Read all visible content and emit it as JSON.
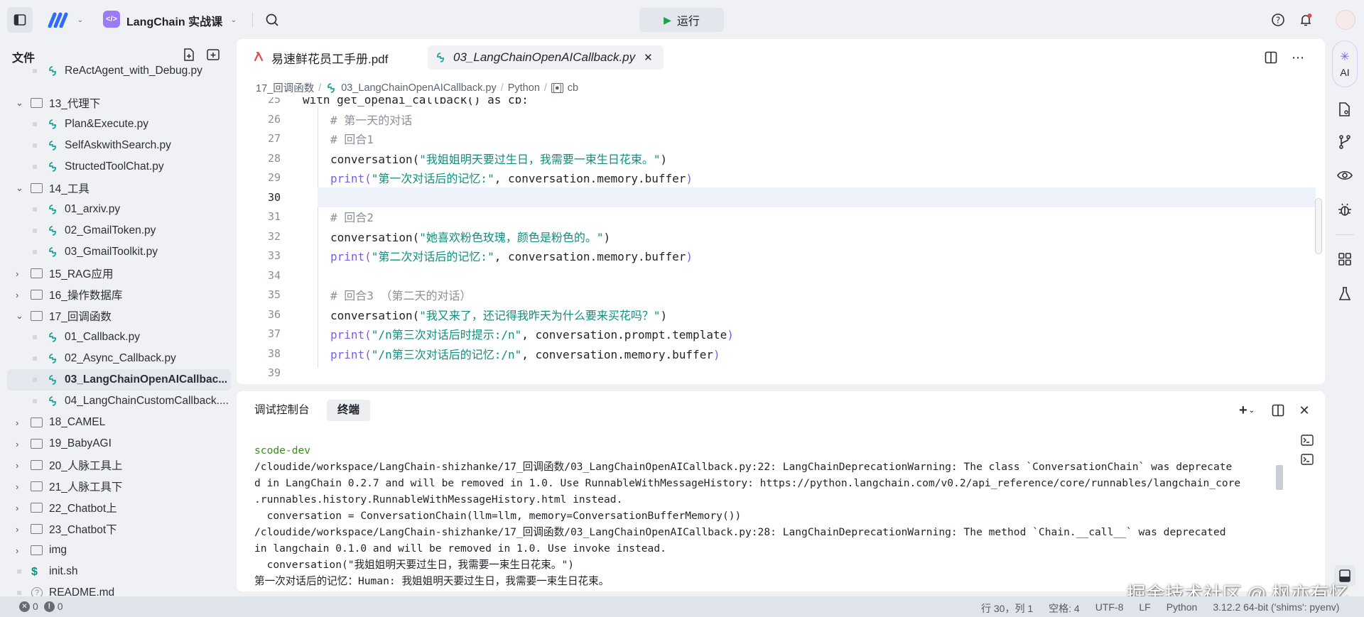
{
  "topbar": {
    "project_name": "LangChain 实战课",
    "run_label": "运行"
  },
  "sidebar": {
    "title": "文件",
    "items": [
      {
        "type": "file",
        "depth": 1,
        "label": "ReActAgent_with_Debug.py",
        "icon": "python"
      },
      {
        "type": "folder",
        "depth": 0,
        "open": true,
        "label": "13_代理下"
      },
      {
        "type": "file",
        "depth": 1,
        "label": "Plan&Execute.py",
        "icon": "python"
      },
      {
        "type": "file",
        "depth": 1,
        "label": "SelfAskwithSearch.py",
        "icon": "python"
      },
      {
        "type": "file",
        "depth": 1,
        "label": "StructedToolChat.py",
        "icon": "python"
      },
      {
        "type": "folder",
        "depth": 0,
        "open": true,
        "label": "14_工具"
      },
      {
        "type": "file",
        "depth": 1,
        "label": "01_arxiv.py",
        "icon": "python"
      },
      {
        "type": "file",
        "depth": 1,
        "label": "02_GmailToken.py",
        "icon": "python"
      },
      {
        "type": "file",
        "depth": 1,
        "label": "03_GmailToolkit.py",
        "icon": "python"
      },
      {
        "type": "folder",
        "depth": 0,
        "open": false,
        "label": "15_RAG应用"
      },
      {
        "type": "folder",
        "depth": 0,
        "open": false,
        "label": "16_操作数据库"
      },
      {
        "type": "folder",
        "depth": 0,
        "open": true,
        "label": "17_回调函数"
      },
      {
        "type": "file",
        "depth": 1,
        "label": "01_Callback.py",
        "icon": "python"
      },
      {
        "type": "file",
        "depth": 1,
        "label": "02_Async_Callback.py",
        "icon": "python"
      },
      {
        "type": "file",
        "depth": 1,
        "label": "03_LangChainOpenAICallbac...",
        "icon": "python",
        "selected": true
      },
      {
        "type": "file",
        "depth": 1,
        "label": "04_LangChainCustomCallback....",
        "icon": "python"
      },
      {
        "type": "folder",
        "depth": 0,
        "open": false,
        "label": "18_CAMEL"
      },
      {
        "type": "folder",
        "depth": 0,
        "open": false,
        "label": "19_BabyAGI"
      },
      {
        "type": "folder",
        "depth": 0,
        "open": false,
        "label": "20_人脉工具上"
      },
      {
        "type": "folder",
        "depth": 0,
        "open": false,
        "label": "21_人脉工具下"
      },
      {
        "type": "folder",
        "depth": 0,
        "open": false,
        "label": "22_Chatbot上"
      },
      {
        "type": "folder",
        "depth": 0,
        "open": false,
        "label": "23_Chatbot下"
      },
      {
        "type": "folder",
        "depth": 0,
        "open": false,
        "label": "img"
      },
      {
        "type": "file",
        "depth": 0,
        "label": "init.sh",
        "icon": "shell"
      },
      {
        "type": "file",
        "depth": 0,
        "label": "README.md",
        "icon": "markdown"
      }
    ]
  },
  "editor": {
    "tabs": [
      {
        "label": "易速鲜花员工手册.pdf",
        "icon": "pdf",
        "active": false
      },
      {
        "label": "03_LangChainOpenAICallback.py",
        "icon": "python",
        "active": true
      }
    ],
    "breadcrumb": [
      "17_回调函数",
      "03_LangChainOpenAICallback.py",
      "Python",
      "cb"
    ],
    "current_line": 30,
    "lines": [
      {
        "n": 25,
        "indent": 0,
        "tokens": [
          [
            "k",
            "with "
          ],
          [
            "f",
            "get_openai_callback() "
          ],
          [
            "k",
            "as "
          ],
          [
            "f",
            "cb:"
          ]
        ]
      },
      {
        "n": 26,
        "indent": 1,
        "tokens": [
          [
            "c",
            "# 第一天的对话"
          ]
        ]
      },
      {
        "n": 27,
        "indent": 1,
        "tokens": [
          [
            "c",
            "# 回合1"
          ]
        ]
      },
      {
        "n": 28,
        "indent": 1,
        "tokens": [
          [
            "f",
            "conversation("
          ],
          [
            "s",
            "\"我姐姐明天要过生日，我需要一束生日花束。\""
          ],
          [
            "f",
            ")"
          ]
        ]
      },
      {
        "n": 29,
        "indent": 1,
        "tokens": [
          [
            "p",
            "print("
          ],
          [
            "s",
            "\"第一次对话后的记忆:\""
          ],
          [
            "f",
            ", conversation.memory.buffer"
          ],
          [
            "p",
            ")"
          ]
        ]
      },
      {
        "n": 30,
        "indent": 1,
        "tokens": []
      },
      {
        "n": 31,
        "indent": 1,
        "tokens": [
          [
            "c",
            "# 回合2"
          ]
        ]
      },
      {
        "n": 32,
        "indent": 1,
        "tokens": [
          [
            "f",
            "conversation("
          ],
          [
            "s",
            "\"她喜欢粉色玫瑰，颜色是粉色的。\""
          ],
          [
            "f",
            ")"
          ]
        ]
      },
      {
        "n": 33,
        "indent": 1,
        "tokens": [
          [
            "p",
            "print("
          ],
          [
            "s",
            "\"第二次对话后的记忆:\""
          ],
          [
            "f",
            ", conversation.memory.buffer"
          ],
          [
            "p",
            ")"
          ]
        ]
      },
      {
        "n": 34,
        "indent": 1,
        "tokens": []
      },
      {
        "n": 35,
        "indent": 1,
        "tokens": [
          [
            "c",
            "# 回合3 （第二天的对话）"
          ]
        ]
      },
      {
        "n": 36,
        "indent": 1,
        "tokens": [
          [
            "f",
            "conversation("
          ],
          [
            "s",
            "\"我又来了，还记得我昨天为什么要来买花吗？\""
          ],
          [
            "f",
            ")"
          ]
        ]
      },
      {
        "n": 37,
        "indent": 1,
        "tokens": [
          [
            "p",
            "print("
          ],
          [
            "s",
            "\"/n第三次对话后时提示:/n\""
          ],
          [
            "f",
            ", conversation.prompt.template"
          ],
          [
            "p",
            ")"
          ]
        ]
      },
      {
        "n": 38,
        "indent": 1,
        "tokens": [
          [
            "p",
            "print("
          ],
          [
            "s",
            "\"/n第三次对话后的记忆:/n\""
          ],
          [
            "f",
            ", conversation.memory.buffer"
          ],
          [
            "p",
            ")"
          ]
        ]
      },
      {
        "n": 39,
        "indent": 0,
        "tokens": []
      }
    ]
  },
  "terminal": {
    "tabs": [
      {
        "label": "调试控制台",
        "active": false
      },
      {
        "label": "终端",
        "active": true
      }
    ],
    "lines": [
      {
        "text": "scode-dev",
        "color": "#3c8a1e"
      },
      {
        "text": "/cloudide/workspace/LangChain-shizhanke/17_回调函数/03_LangChainOpenAICallback.py:22: LangChainDeprecationWarning: The class `ConversationChain` was deprecate"
      },
      {
        "text": "d in LangChain 0.2.7 and will be removed in 1.0. Use RunnableWithMessageHistory: https://python.langchain.com/v0.2/api_reference/core/runnables/langchain_core"
      },
      {
        "text": ".runnables.history.RunnableWithMessageHistory.html instead."
      },
      {
        "text": "  conversation = ConversationChain(llm=llm, memory=ConversationBufferMemory())"
      },
      {
        "text": "/cloudide/workspace/LangChain-shizhanke/17_回调函数/03_LangChainOpenAICallback.py:28: LangChainDeprecationWarning: The method `Chain.__call__` was deprecated"
      },
      {
        "text": "in langchain 0.1.0 and will be removed in 1.0. Use invoke instead."
      },
      {
        "text": "  conversation(\"我姐姐明天要过生日，我需要一束生日花束。\")"
      },
      {
        "text": "第一次对话后的记忆：Human: 我姐姐明天要过生日，我需要一束生日花束。"
      }
    ]
  },
  "activity_bar": {
    "ai_label": "AI"
  },
  "status": {
    "errors": "0",
    "warnings": "0",
    "position": "行 30，列 1",
    "spaces": "空格: 4",
    "encoding": "UTF-8",
    "eol": "LF",
    "language": "Python",
    "interpreter": "3.12.2 64-bit ('shims': pyenv)"
  },
  "watermark": "掘金技术社区 @ 枫亦有忆",
  "colors": {
    "accent": "#7a5cf0",
    "string": "#0e8f80",
    "comment": "#8a8f99",
    "run": "#17a34a",
    "terminal_host": "#3c8a1e"
  }
}
